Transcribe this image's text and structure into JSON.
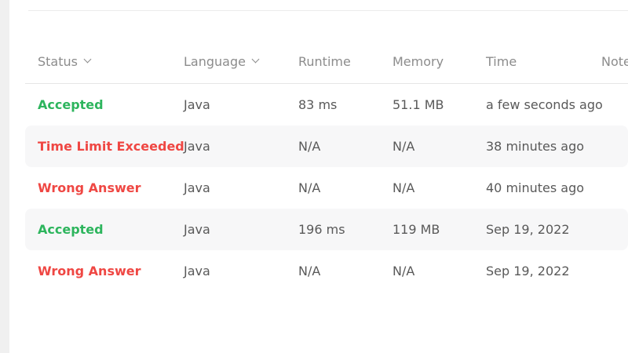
{
  "colors": {
    "accepted": "#2db55d",
    "rejected": "#ef4743",
    "header_text": "#8c8c8c",
    "stripe": "#f7f7f8"
  },
  "table": {
    "headers": {
      "status": "Status",
      "language": "Language",
      "runtime": "Runtime",
      "memory": "Memory",
      "time": "Time",
      "notes": "Note"
    },
    "header_icons": {
      "status": "chevron-down-icon",
      "language": "chevron-down-icon"
    },
    "rows": [
      {
        "status": "Accepted",
        "status_kind": "accepted",
        "language": "Java",
        "runtime": "83 ms",
        "memory": "51.1 MB",
        "time": "a few seconds ago"
      },
      {
        "status": "Time Limit Exceeded",
        "status_kind": "rejected",
        "language": "Java",
        "runtime": "N/A",
        "memory": "N/A",
        "time": "38 minutes ago"
      },
      {
        "status": "Wrong Answer",
        "status_kind": "rejected",
        "language": "Java",
        "runtime": "N/A",
        "memory": "N/A",
        "time": "40 minutes ago"
      },
      {
        "status": "Accepted",
        "status_kind": "accepted",
        "language": "Java",
        "runtime": "196 ms",
        "memory": "119 MB",
        "time": "Sep 19, 2022"
      },
      {
        "status": "Wrong Answer",
        "status_kind": "rejected",
        "language": "Java",
        "runtime": "N/A",
        "memory": "N/A",
        "time": "Sep 19, 2022"
      }
    ]
  }
}
